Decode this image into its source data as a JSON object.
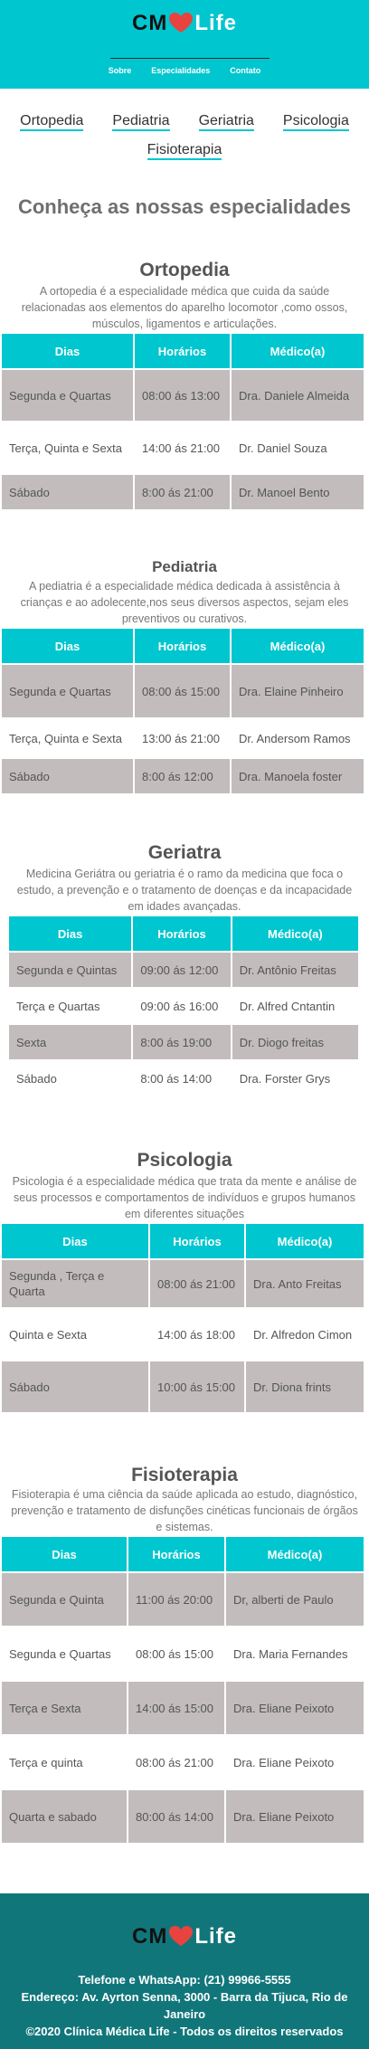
{
  "header": {
    "logo_left": "CM",
    "logo_right": "Life",
    "nav": [
      "Sobre",
      "Especialidades",
      "Contato"
    ]
  },
  "specialty_links": [
    "Ortopedia",
    "Pediatria",
    "Geriatria",
    "Psicologia",
    "Fisioterapia"
  ],
  "main_title": "Conheça as nossas especialidades",
  "table_headers": [
    "Dias",
    "Horários",
    "Médico(a)"
  ],
  "sections": [
    {
      "title": "Ortopedia",
      "description": "A ortopedia é a especialidade médica que cuida da saúde relacionadas aos elementos do aparelho locomotor ,como ossos, músculos, ligamentos e articulações.",
      "rows": [
        [
          "Segunda e Quartas",
          "08:00 ás 13:00",
          "Dra. Daniele Almeida"
        ],
        [
          "Terça, Quinta e Sexta",
          "14:00 ás 21:00",
          "Dr. Daniel Souza"
        ],
        [
          "Sábado",
          "8:00 ás 21:00",
          "Dr. Manoel Bento"
        ]
      ]
    },
    {
      "title": "Pediatria",
      "description": "A pediatria é a especialidade médica dedicada à assistência à crianças e ao adolecente,nos seus diversos aspectos, sejam eles preventivos ou curativos.",
      "rows": [
        [
          "Segunda e Quartas",
          "08:00 ás 15:00",
          "Dra. Elaine Pinheiro"
        ],
        [
          "Terça, Quinta e Sexta",
          "13:00 ás 21:00",
          "Dr. Andersom Ramos"
        ],
        [
          "Sábado",
          "8:00 ás 12:00",
          "Dra. Manoela foster"
        ]
      ]
    },
    {
      "title": "Geriatra",
      "description": "Medicina Geriátra ou geriatria é o ramo da medicina que foca o estudo, a prevenção e o tratamento de doenças e da incapacidade em idades avançadas.",
      "rows": [
        [
          "Segunda e Quintas",
          "09:00 ás 12:00",
          "Dr. Antônio Freitas"
        ],
        [
          "Terça e Quartas",
          "09:00 ás 16:00",
          "Dr. Alfred Cntantin"
        ],
        [
          "Sexta",
          "8:00 ás 19:00",
          "Dr. Diogo freitas"
        ],
        [
          "Sábado",
          "8:00 ás 14:00",
          "Dra. Forster Grys"
        ]
      ]
    },
    {
      "title": "Psicologia",
      "description": "Psicologia é a especialidade médica que trata da mente e análise de seus processos e comportamentos de indivíduos e grupos humanos em diferentes situações",
      "rows": [
        [
          "Segunda , Terça e Quarta",
          "08:00 ás 21:00",
          "Dra. Anto Freitas"
        ],
        [
          "Quinta e Sexta",
          "14:00 ás 18:00",
          "Dr. Alfredon Cimon"
        ],
        [
          "Sábado",
          "10:00 ás 15:00",
          "Dr. Diona frints"
        ]
      ]
    },
    {
      "title": "Fisioterapia",
      "description": "Fisioterapia é uma ciência da saúde aplicada ao estudo, diagnóstico, prevenção e tratamento de disfunções cinéticas funcionais de órgãos e sistemas.",
      "rows": [
        [
          "Segunda e Quinta",
          "11:00 ás 20:00",
          "Dr, alberti de Paulo"
        ],
        [
          "Segunda e Quartas",
          "08:00 ás 15:00",
          "Dra. Maria Fernandes"
        ],
        [
          "Terça e Sexta",
          "14:00 ás 15:00",
          "Dra. Eliane Peixoto"
        ],
        [
          "Terça e quinta",
          "08:00 ás 21:00",
          "Dra. Eliane Peixoto"
        ],
        [
          "Quarta e sabado",
          "80:00 ás 14:00",
          "Dra. Eliane Peixoto"
        ]
      ]
    }
  ],
  "footer": {
    "phone": "Telefone e WhatsApp: (21) 99966-5555",
    "address": "Endereço: Av. Ayrton Senna, 3000 - Barra da Tijuca, Rio de Janeiro",
    "copyright": "©2020 Clínica Médica Life - Todos os direitos reservados"
  },
  "colors": {
    "accent": "#00c6cf",
    "row_shade": "#c2bcbc",
    "footer_bg": "#11767a",
    "heart": "#e8433f"
  }
}
